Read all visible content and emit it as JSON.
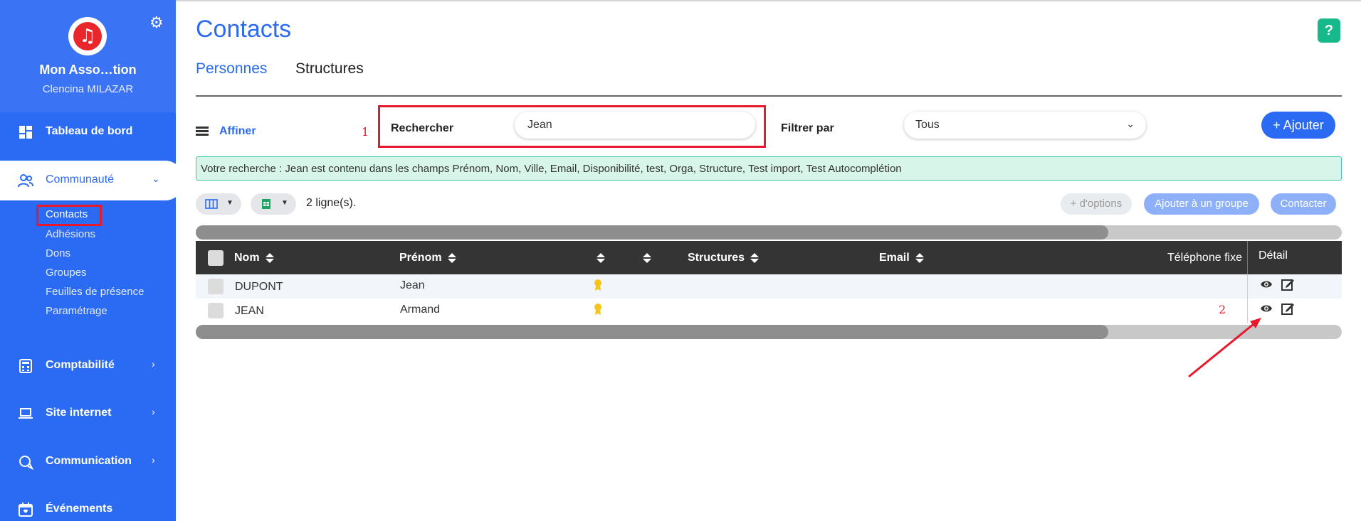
{
  "sidebar": {
    "org_name": "Mon Asso…tion",
    "user_name": "Clencina MILAZAR",
    "nav": [
      {
        "label": "Tableau de bord",
        "icon": "dashboard-icon"
      },
      {
        "label": "Communauté",
        "icon": "users-icon"
      },
      {
        "label": "Comptabilité",
        "icon": "calculator-icon"
      },
      {
        "label": "Site internet",
        "icon": "laptop-icon"
      },
      {
        "label": "Communication",
        "icon": "chat-icon"
      },
      {
        "label": "Événements",
        "icon": "calendar-icon"
      }
    ],
    "subnav": [
      "Contacts",
      "Adhésions",
      "Dons",
      "Groupes",
      "Feuilles de présence",
      "Paramétrage"
    ]
  },
  "header": {
    "title": "Contacts",
    "help": "?",
    "tabs": [
      "Personnes",
      "Structures"
    ]
  },
  "filters": {
    "affiner": "Affiner",
    "search_label": "Rechercher",
    "search_value": "Jean",
    "filter_label": "Filtrer par",
    "filter_value": "Tous",
    "add_button": "+ Ajouter"
  },
  "annotations": {
    "label1": "1",
    "label2": "2"
  },
  "info": "Votre recherche : Jean est contenu dans les champs Prénom, Nom, Ville, Email, Disponibilité, test, Orga, Structure, Test import, Test Autocomplétion",
  "toolbar": {
    "rows_count": "2 ligne(s).",
    "options": "+ d'options",
    "add_group": "Ajouter à un groupe",
    "contact": "Contacter"
  },
  "table": {
    "columns": [
      "Nom",
      "Prénom",
      "Structures",
      "Email",
      "Téléphone fixe",
      "Détail"
    ],
    "rows": [
      {
        "nom": "DUPONT",
        "prenom": "Jean"
      },
      {
        "nom": "JEAN",
        "prenom": "Armand"
      }
    ]
  },
  "colors": {
    "primary": "#2b6af2",
    "annotation": "#e8192c",
    "info_bg": "#d8f5ea",
    "help": "#17b889"
  }
}
